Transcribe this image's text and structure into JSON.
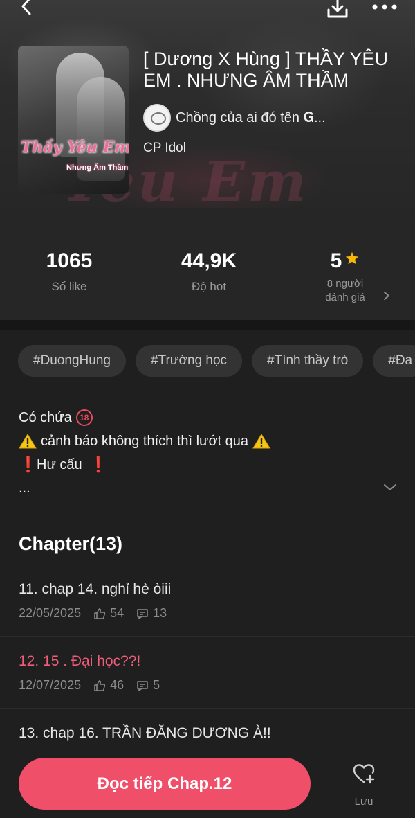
{
  "header": {
    "title": "[ Dương X Hùng ] THẦY YÊU EM . NHƯNG ÂM THẦM",
    "author": "Chồng của ai đó tên 𝐆...",
    "category": "CP Idol",
    "cover_title": "Thầy Yêu Em",
    "cover_subtitle": "Nhưng Âm Thầm",
    "background_text": "Yêu Em"
  },
  "stats": {
    "likes_value": "1065",
    "likes_label": "Số like",
    "hot_value": "44,9K",
    "hot_label": "Độ hot",
    "rating_value": "5",
    "rating_count_line1": "8 người",
    "rating_count_line2": "đánh giá"
  },
  "tags": [
    "#DuongHung",
    "#Trường học",
    "#Tình thầy trò",
    "#Đa"
  ],
  "description": {
    "line1": "Có chứa",
    "line1_badge": "18",
    "line2": "cảnh báo không thích thì lướt qua",
    "line3": "Hư cấu",
    "excl": "❗",
    "ellipsis": "..."
  },
  "chapters": {
    "heading": "Chapter(13)",
    "items": [
      {
        "title": "11. chap 14. nghỉ hè òiii",
        "date": "22/05/2025",
        "likes": "54",
        "comments": "13"
      },
      {
        "title": "12. 15 . Đại học??!",
        "date": "12/07/2025",
        "likes": "46",
        "comments": "5"
      },
      {
        "title": "13. chap 16. TRẦN ĐĂNG DƯƠNG À!!"
      }
    ]
  },
  "actions": {
    "read_label": "Đọc tiếp Chap.12",
    "save_label": "Lưu"
  },
  "colors": {
    "accent": "#f04f6a",
    "active_chapter": "#ef5d7a",
    "star": "#f5b70a"
  }
}
